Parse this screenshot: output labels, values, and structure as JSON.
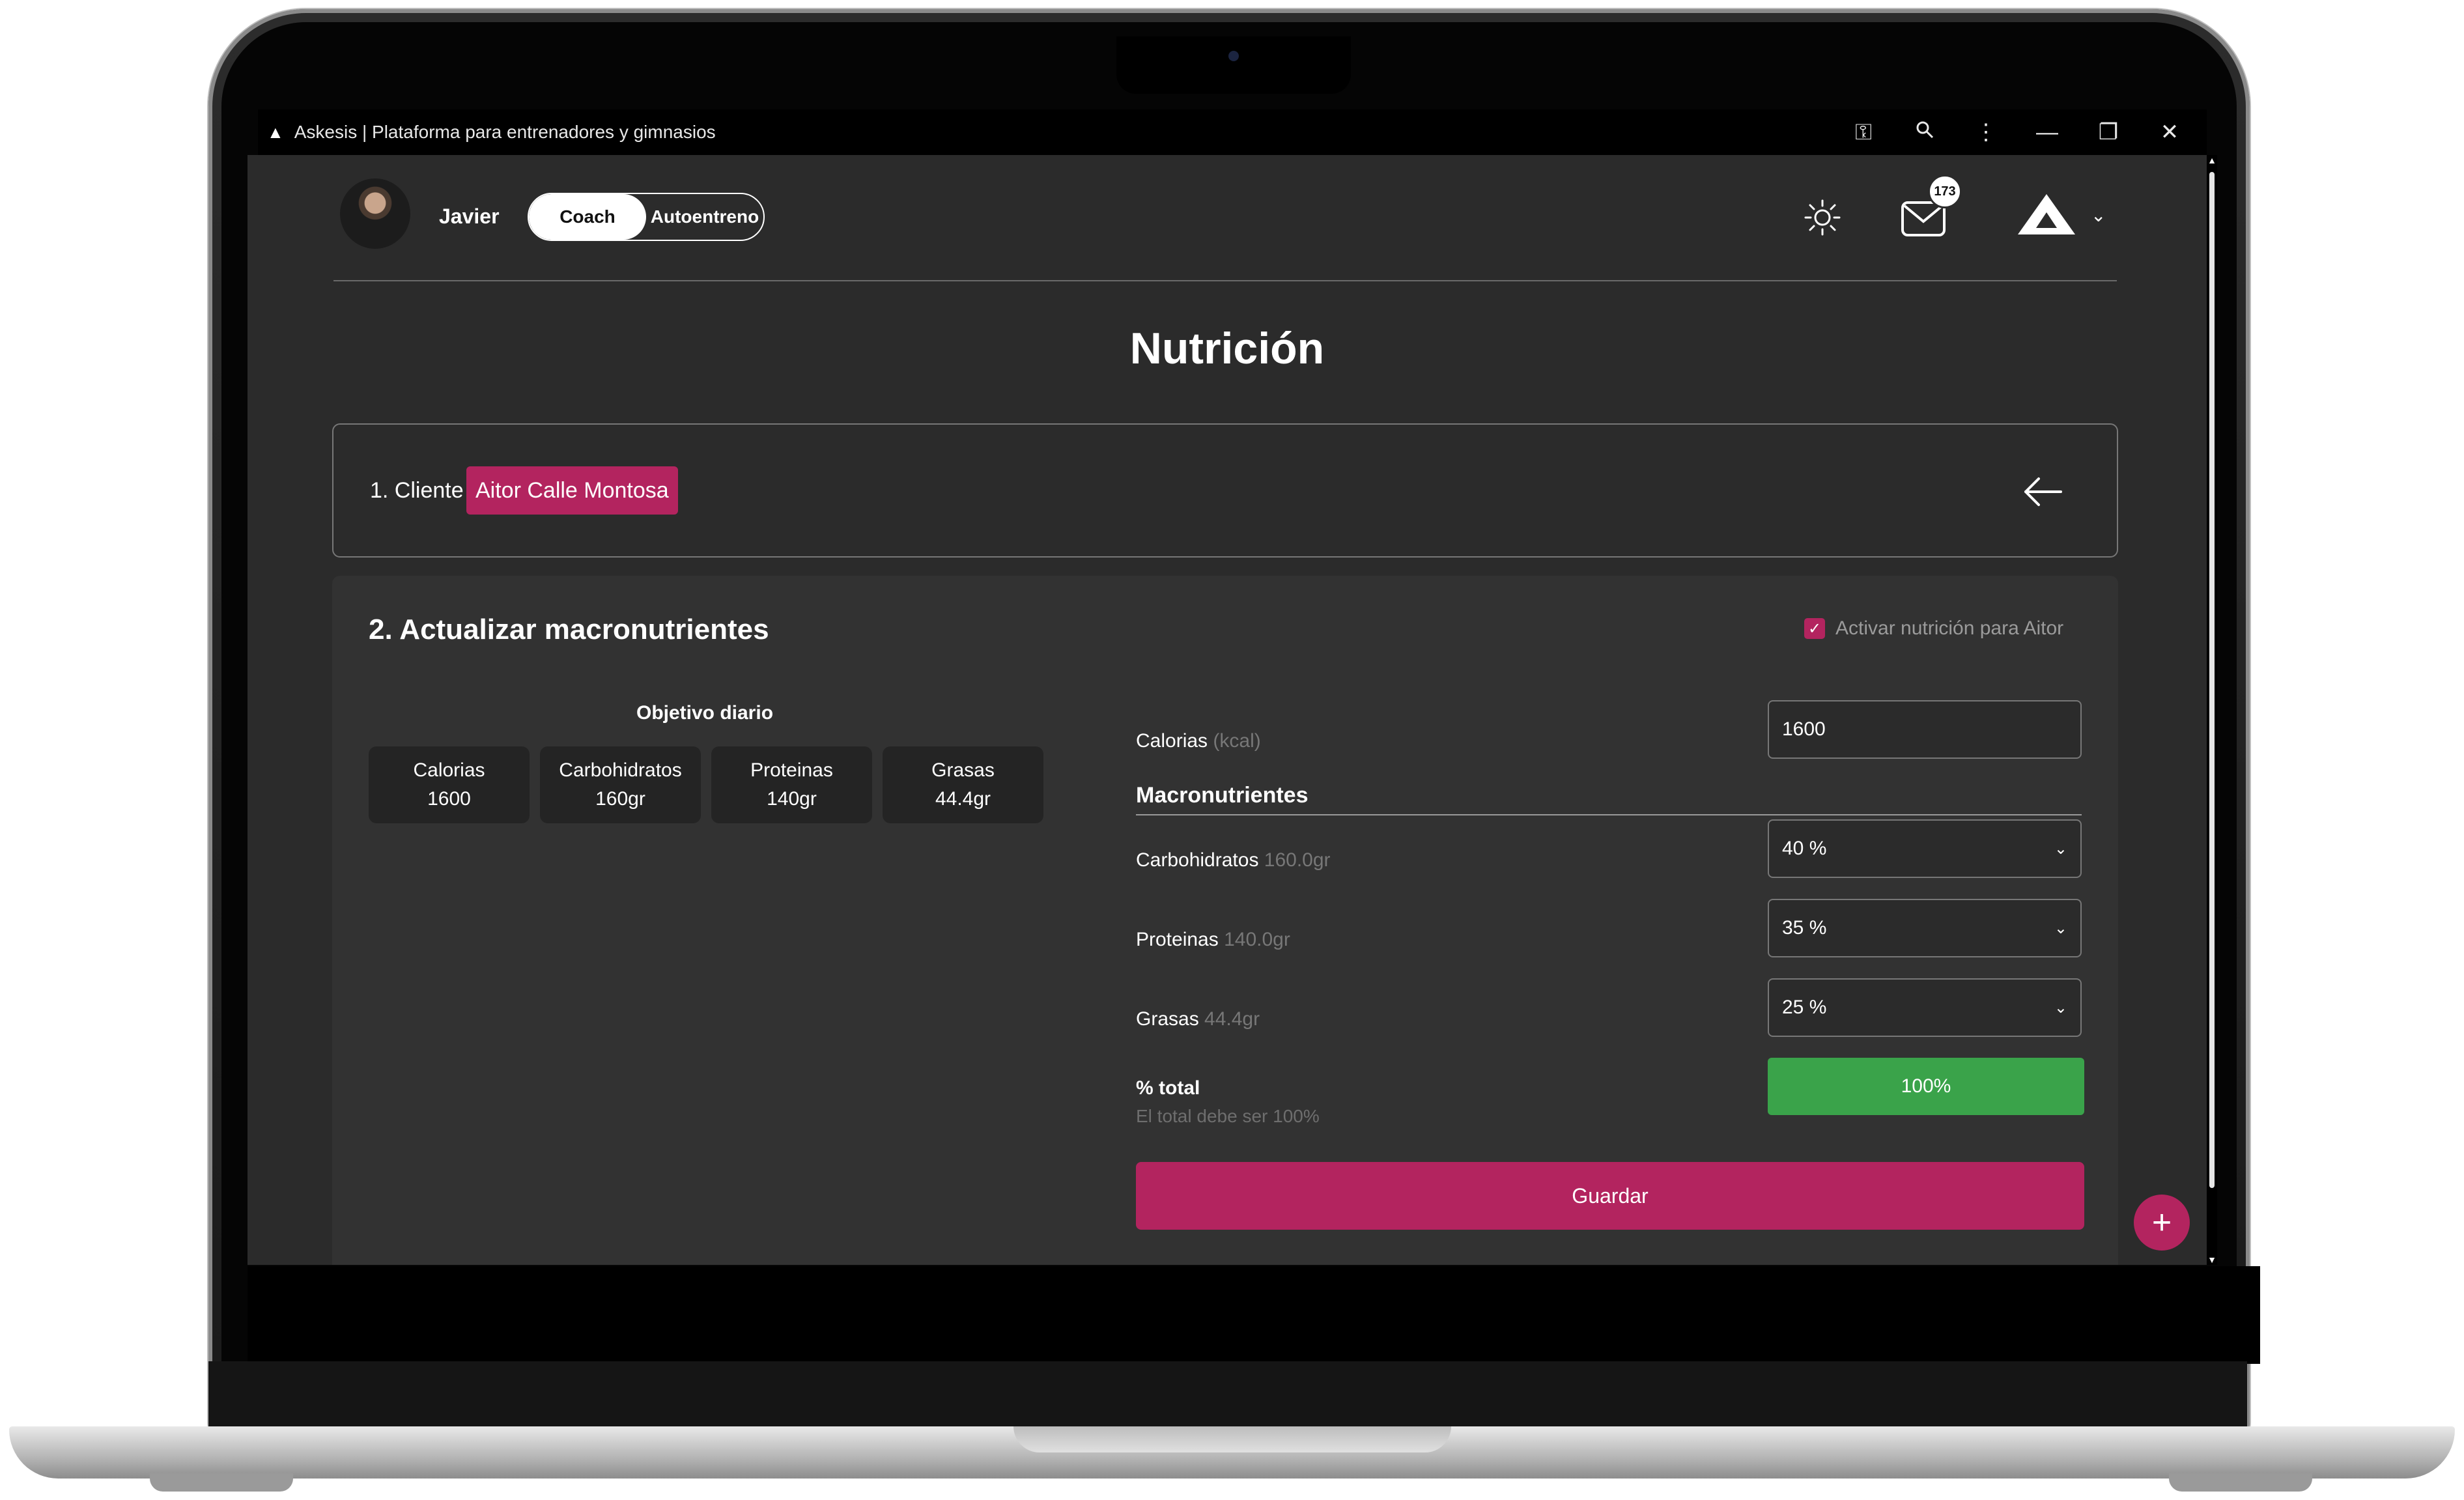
{
  "window": {
    "title": "Askesis | Plataforma para entrenadores y gimnasios",
    "controls": [
      "key-icon",
      "zoom-icon",
      "more-icon",
      "minimize-icon",
      "restore-icon",
      "close-icon"
    ]
  },
  "header": {
    "user_name": "Javier",
    "mode_options": [
      "Coach",
      "Autoentreno"
    ],
    "selected_mode": "Coach",
    "notifications_count": "173"
  },
  "page": {
    "title": "Nutrición"
  },
  "client_section": {
    "label": "1. Cliente",
    "client_name": "Aitor Calle Montosa"
  },
  "macros_section": {
    "title": "2. Actualizar macronutrientes",
    "activate_label": "Activar nutrición para Aitor",
    "activate_checked": true,
    "goal_title": "Objetivo diario",
    "goal_cards": [
      {
        "label": "Calorias",
        "value": "1600"
      },
      {
        "label": "Carbohidratos",
        "value": "160gr"
      },
      {
        "label": "Proteinas",
        "value": "140gr"
      },
      {
        "label": "Grasas",
        "value": "44.4gr"
      }
    ],
    "calories": {
      "label": "Calorias",
      "hint": "(kcal)",
      "value": "1600"
    },
    "macronutrients_heading": "Macronutrientes",
    "macros": [
      {
        "label": "Carbohidratos",
        "hint": "160.0gr",
        "value": "40 %"
      },
      {
        "label": "Proteinas",
        "hint": "140.0gr",
        "value": "35 %"
      },
      {
        "label": "Grasas",
        "hint": "44.4gr",
        "value": "25 %"
      }
    ],
    "total_label": "% total",
    "total_note": "El total debe ser 100%",
    "total_value": "100%",
    "save_label": "Guardar"
  },
  "fab_label": "+",
  "colors": {
    "accent": "#b3245f",
    "success": "#3aa34a",
    "background": "#2b2b2b",
    "panel": "#323232"
  }
}
